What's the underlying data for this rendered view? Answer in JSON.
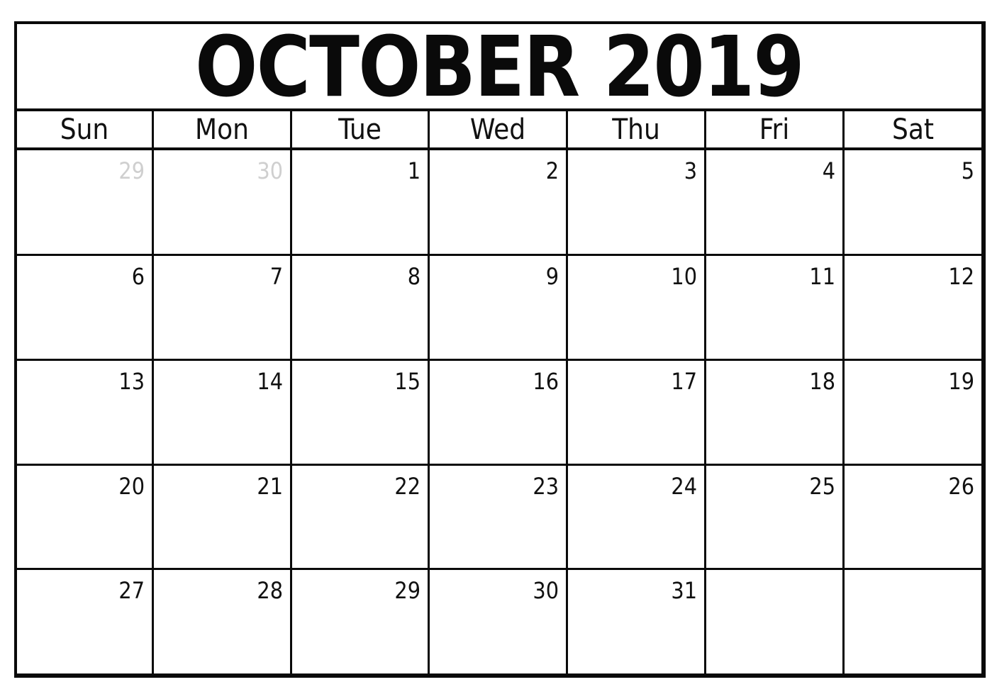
{
  "title": "OCTOBER 2019",
  "weekdays": [
    "Sun",
    "Mon",
    "Tue",
    "Wed",
    "Thu",
    "Fri",
    "Sat"
  ],
  "weeks": [
    [
      {
        "day": "29",
        "muted": true
      },
      {
        "day": "30",
        "muted": true
      },
      {
        "day": "1"
      },
      {
        "day": "2"
      },
      {
        "day": "3"
      },
      {
        "day": "4"
      },
      {
        "day": "5"
      }
    ],
    [
      {
        "day": "6"
      },
      {
        "day": "7"
      },
      {
        "day": "8"
      },
      {
        "day": "9"
      },
      {
        "day": "10"
      },
      {
        "day": "11"
      },
      {
        "day": "12"
      }
    ],
    [
      {
        "day": "13"
      },
      {
        "day": "14"
      },
      {
        "day": "15"
      },
      {
        "day": "16"
      },
      {
        "day": "17"
      },
      {
        "day": "18"
      },
      {
        "day": "19"
      }
    ],
    [
      {
        "day": "20"
      },
      {
        "day": "21"
      },
      {
        "day": "22"
      },
      {
        "day": "23"
      },
      {
        "day": "24"
      },
      {
        "day": "25"
      },
      {
        "day": "26"
      }
    ],
    [
      {
        "day": "27"
      },
      {
        "day": "28"
      },
      {
        "day": "29"
      },
      {
        "day": "30"
      },
      {
        "day": "31"
      },
      {
        "day": ""
      },
      {
        "day": ""
      }
    ]
  ],
  "colors": {
    "line": "#0a0a0a",
    "text": "#111111",
    "muted_day": "#cfcfcf",
    "background": "#ffffff"
  }
}
